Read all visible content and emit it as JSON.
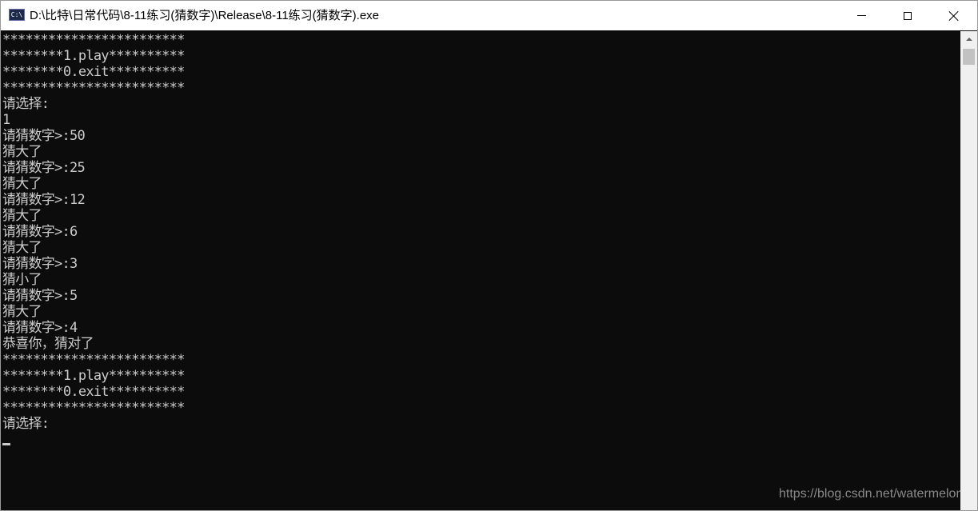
{
  "window": {
    "title": "D:\\比特\\日常代码\\8-11练习(猜数字)\\Release\\8-11练习(猜数字).exe",
    "app_icon": "console-app-icon",
    "app_icon_text": "C:\\",
    "controls": {
      "minimize": "minimize-icon",
      "maximize": "maximize-icon",
      "close": "close-icon"
    }
  },
  "console": {
    "background": "#0c0c0c",
    "foreground": "#cccccc",
    "lines": [
      "************************",
      "********1.play**********",
      "********0.exit**********",
      "************************",
      "请选择:",
      "1",
      "请猜数字>:50",
      "猜大了",
      "请猜数字>:25",
      "猜大了",
      "请猜数字>:12",
      "猜大了",
      "请猜数字>:6",
      "猜大了",
      "请猜数字>:3",
      "猜小了",
      "请猜数字>:5",
      "猜大了",
      "请猜数字>:4",
      "恭喜你，猜对了",
      "************************",
      "********1.play**********",
      "********0.exit**********",
      "************************",
      "请选择:"
    ]
  },
  "watermark": "https://blog.csdn.net/watermelon"
}
